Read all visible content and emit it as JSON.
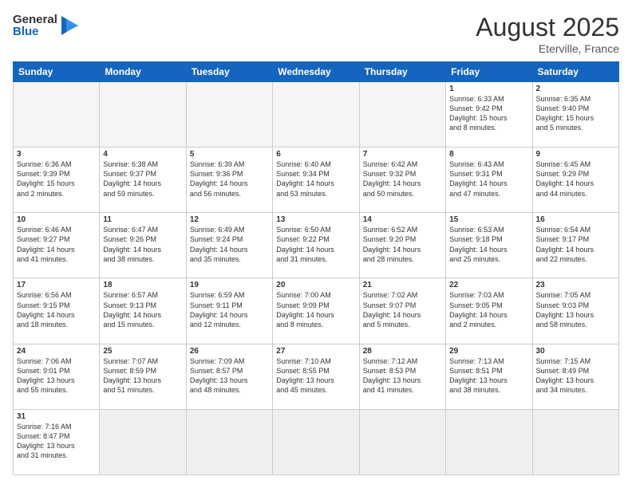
{
  "header": {
    "logo_general": "General",
    "logo_blue": "Blue",
    "month_year": "August 2025",
    "location": "Eterville, France"
  },
  "days_of_week": [
    "Sunday",
    "Monday",
    "Tuesday",
    "Wednesday",
    "Thursday",
    "Friday",
    "Saturday"
  ],
  "weeks": [
    [
      {
        "day": "",
        "info": ""
      },
      {
        "day": "",
        "info": ""
      },
      {
        "day": "",
        "info": ""
      },
      {
        "day": "",
        "info": ""
      },
      {
        "day": "",
        "info": ""
      },
      {
        "day": "1",
        "info": "Sunrise: 6:33 AM\nSunset: 9:42 PM\nDaylight: 15 hours\nand 8 minutes."
      },
      {
        "day": "2",
        "info": "Sunrise: 6:35 AM\nSunset: 9:40 PM\nDaylight: 15 hours\nand 5 minutes."
      }
    ],
    [
      {
        "day": "3",
        "info": "Sunrise: 6:36 AM\nSunset: 9:39 PM\nDaylight: 15 hours\nand 2 minutes."
      },
      {
        "day": "4",
        "info": "Sunrise: 6:38 AM\nSunset: 9:37 PM\nDaylight: 14 hours\nand 59 minutes."
      },
      {
        "day": "5",
        "info": "Sunrise: 6:39 AM\nSunset: 9:36 PM\nDaylight: 14 hours\nand 56 minutes."
      },
      {
        "day": "6",
        "info": "Sunrise: 6:40 AM\nSunset: 9:34 PM\nDaylight: 14 hours\nand 53 minutes."
      },
      {
        "day": "7",
        "info": "Sunrise: 6:42 AM\nSunset: 9:32 PM\nDaylight: 14 hours\nand 50 minutes."
      },
      {
        "day": "8",
        "info": "Sunrise: 6:43 AM\nSunset: 9:31 PM\nDaylight: 14 hours\nand 47 minutes."
      },
      {
        "day": "9",
        "info": "Sunrise: 6:45 AM\nSunset: 9:29 PM\nDaylight: 14 hours\nand 44 minutes."
      }
    ],
    [
      {
        "day": "10",
        "info": "Sunrise: 6:46 AM\nSunset: 9:27 PM\nDaylight: 14 hours\nand 41 minutes."
      },
      {
        "day": "11",
        "info": "Sunrise: 6:47 AM\nSunset: 9:26 PM\nDaylight: 14 hours\nand 38 minutes."
      },
      {
        "day": "12",
        "info": "Sunrise: 6:49 AM\nSunset: 9:24 PM\nDaylight: 14 hours\nand 35 minutes."
      },
      {
        "day": "13",
        "info": "Sunrise: 6:50 AM\nSunset: 9:22 PM\nDaylight: 14 hours\nand 31 minutes."
      },
      {
        "day": "14",
        "info": "Sunrise: 6:52 AM\nSunset: 9:20 PM\nDaylight: 14 hours\nand 28 minutes."
      },
      {
        "day": "15",
        "info": "Sunrise: 6:53 AM\nSunset: 9:18 PM\nDaylight: 14 hours\nand 25 minutes."
      },
      {
        "day": "16",
        "info": "Sunrise: 6:54 AM\nSunset: 9:17 PM\nDaylight: 14 hours\nand 22 minutes."
      }
    ],
    [
      {
        "day": "17",
        "info": "Sunrise: 6:56 AM\nSunset: 9:15 PM\nDaylight: 14 hours\nand 18 minutes."
      },
      {
        "day": "18",
        "info": "Sunrise: 6:57 AM\nSunset: 9:13 PM\nDaylight: 14 hours\nand 15 minutes."
      },
      {
        "day": "19",
        "info": "Sunrise: 6:59 AM\nSunset: 9:11 PM\nDaylight: 14 hours\nand 12 minutes."
      },
      {
        "day": "20",
        "info": "Sunrise: 7:00 AM\nSunset: 9:09 PM\nDaylight: 14 hours\nand 8 minutes."
      },
      {
        "day": "21",
        "info": "Sunrise: 7:02 AM\nSunset: 9:07 PM\nDaylight: 14 hours\nand 5 minutes."
      },
      {
        "day": "22",
        "info": "Sunrise: 7:03 AM\nSunset: 9:05 PM\nDaylight: 14 hours\nand 2 minutes."
      },
      {
        "day": "23",
        "info": "Sunrise: 7:05 AM\nSunset: 9:03 PM\nDaylight: 13 hours\nand 58 minutes."
      }
    ],
    [
      {
        "day": "24",
        "info": "Sunrise: 7:06 AM\nSunset: 9:01 PM\nDaylight: 13 hours\nand 55 minutes."
      },
      {
        "day": "25",
        "info": "Sunrise: 7:07 AM\nSunset: 8:59 PM\nDaylight: 13 hours\nand 51 minutes."
      },
      {
        "day": "26",
        "info": "Sunrise: 7:09 AM\nSunset: 8:57 PM\nDaylight: 13 hours\nand 48 minutes."
      },
      {
        "day": "27",
        "info": "Sunrise: 7:10 AM\nSunset: 8:55 PM\nDaylight: 13 hours\nand 45 minutes."
      },
      {
        "day": "28",
        "info": "Sunrise: 7:12 AM\nSunset: 8:53 PM\nDaylight: 13 hours\nand 41 minutes."
      },
      {
        "day": "29",
        "info": "Sunrise: 7:13 AM\nSunset: 8:51 PM\nDaylight: 13 hours\nand 38 minutes."
      },
      {
        "day": "30",
        "info": "Sunrise: 7:15 AM\nSunset: 8:49 PM\nDaylight: 13 hours\nand 34 minutes."
      }
    ],
    [
      {
        "day": "31",
        "info": "Sunrise: 7:16 AM\nSunset: 8:47 PM\nDaylight: 13 hours\nand 31 minutes."
      },
      {
        "day": "",
        "info": ""
      },
      {
        "day": "",
        "info": ""
      },
      {
        "day": "",
        "info": ""
      },
      {
        "day": "",
        "info": ""
      },
      {
        "day": "",
        "info": ""
      },
      {
        "day": "",
        "info": ""
      }
    ]
  ]
}
